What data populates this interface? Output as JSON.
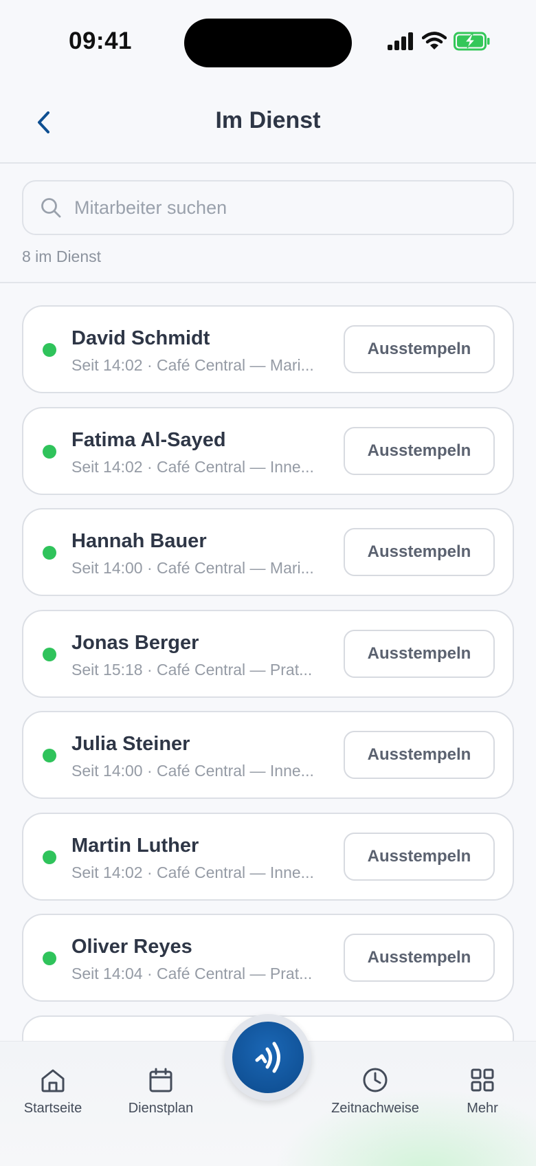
{
  "status_bar": {
    "time": "09:41"
  },
  "header": {
    "title": "Im Dienst"
  },
  "search": {
    "placeholder": "Mitarbeiter suchen"
  },
  "summary": {
    "count_label": "8 im Dienst"
  },
  "employees": [
    {
      "name": "David Schmidt",
      "detail": "Seit 14:02 · Café Central — Mari...",
      "action": "Ausstempeln"
    },
    {
      "name": "Fatima Al-Sayed",
      "detail": "Seit 14:02 · Café Central — Inne...",
      "action": "Ausstempeln"
    },
    {
      "name": "Hannah Bauer",
      "detail": "Seit 14:00 · Café Central — Mari...",
      "action": "Ausstempeln"
    },
    {
      "name": "Jonas Berger",
      "detail": "Seit 15:18 · Café Central — Prat...",
      "action": "Ausstempeln"
    },
    {
      "name": "Julia Steiner",
      "detail": "Seit 14:00 · Café Central — Inne...",
      "action": "Ausstempeln"
    },
    {
      "name": "Martin Luther",
      "detail": "Seit 14:02 · Café Central — Inne...",
      "action": "Ausstempeln"
    },
    {
      "name": "Oliver Reyes",
      "detail": "Seit 14:04 · Café Central — Prat...",
      "action": "Ausstempeln"
    }
  ],
  "nav": {
    "home": "Startseite",
    "schedule": "Dienstplan",
    "timesheets": "Zeitnachweise",
    "more": "Mehr"
  },
  "colors": {
    "online_dot": "#2fc35b",
    "primary": "#0e4f92",
    "text": "#2e3646",
    "muted": "#959ba5"
  }
}
